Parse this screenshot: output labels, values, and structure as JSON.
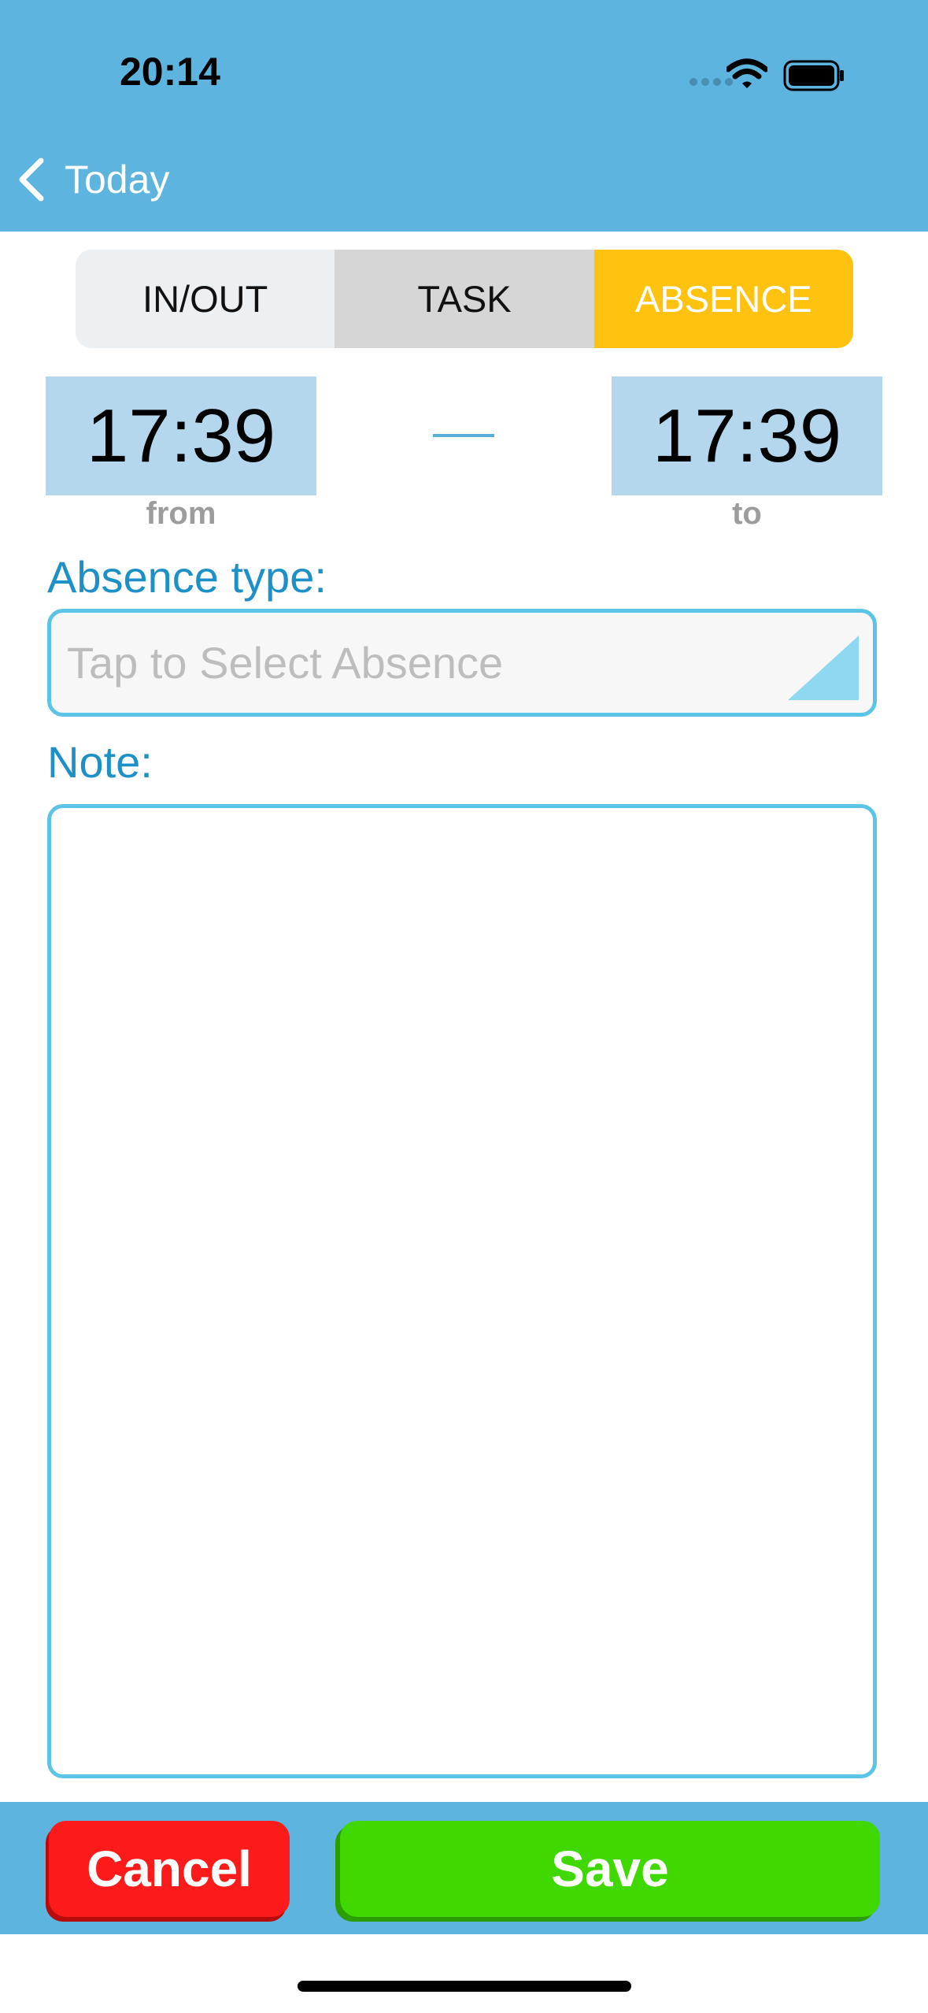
{
  "status_bar": {
    "time": "20:14",
    "icons": [
      "signal-dots-icon",
      "wifi-icon",
      "battery-icon"
    ]
  },
  "nav": {
    "back_label": "Today"
  },
  "tabs": [
    {
      "label": "IN/OUT",
      "selected": false
    },
    {
      "label": "TASK",
      "selected": false
    },
    {
      "label": "ABSENCE",
      "selected": true
    }
  ],
  "time_range": {
    "from_value": "17:39",
    "from_label": "from",
    "to_value": "17:39",
    "to_label": "to"
  },
  "absence": {
    "label": "Absence type:",
    "placeholder": "Tap to Select Absence"
  },
  "note": {
    "label": "Note:",
    "value": ""
  },
  "actions": {
    "cancel_label": "Cancel",
    "save_label": "Save"
  },
  "colors": {
    "header": "#5db4df",
    "accent_yellow": "#ffc20e",
    "cancel_red": "#fb1b1b",
    "save_green": "#3fd800",
    "field_border": "#5cc4e6",
    "label_blue": "#1e90c8"
  }
}
